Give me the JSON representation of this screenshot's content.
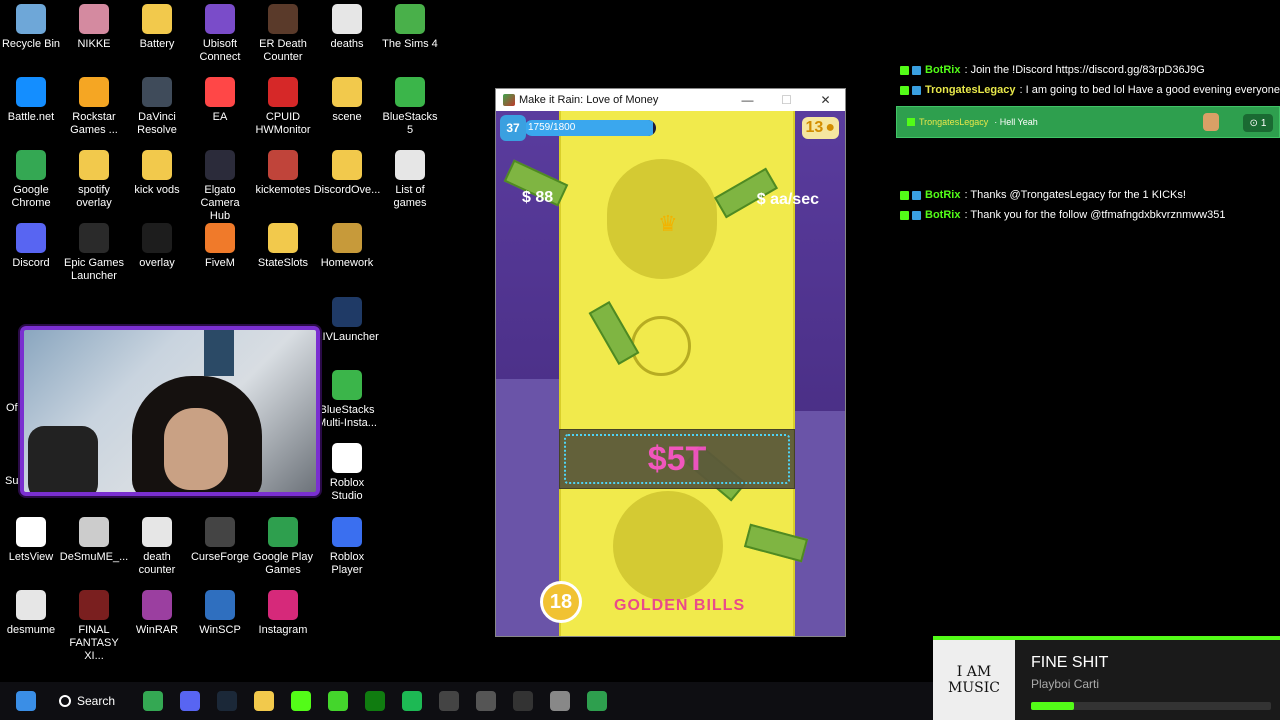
{
  "desktop_icons": [
    {
      "label": "Recycle Bin",
      "icon": "recycle-bin-icon",
      "color": "#6ea7d8"
    },
    {
      "label": "NIKKE",
      "icon": "nikke-icon",
      "color": "#d48aa0"
    },
    {
      "label": "Battery",
      "icon": "folder-icon",
      "color": "#f2c94c"
    },
    {
      "label": "Ubisoft\nConnect",
      "icon": "ubisoft-icon",
      "color": "#7a4cc9"
    },
    {
      "label": "ER Death\nCounter",
      "icon": "er-death-counter-icon",
      "color": "#5a3a2a"
    },
    {
      "label": "deaths",
      "icon": "file-icon",
      "color": "#e6e6e6"
    },
    {
      "label": "The Sims 4",
      "icon": "sims-icon",
      "color": "#49b04a"
    },
    {
      "label": "Battle.net",
      "icon": "battlenet-icon",
      "color": "#148eff"
    },
    {
      "label": "Rockstar\nGames ...",
      "icon": "rockstar-icon",
      "color": "#f5a623"
    },
    {
      "label": "DaVinci\nResolve",
      "icon": "davinci-icon",
      "color": "#3f4b5a"
    },
    {
      "label": "EA",
      "icon": "ea-icon",
      "color": "#ff4747"
    },
    {
      "label": "CPUID\nHWMonitor",
      "icon": "hwmonitor-icon",
      "color": "#d62828"
    },
    {
      "label": "scene",
      "icon": "folder-icon",
      "color": "#f2c94c"
    },
    {
      "label": "BlueStacks 5",
      "icon": "bluestacks-icon",
      "color": "#3bb54a"
    },
    {
      "label": "Google\nChrome",
      "icon": "chrome-icon",
      "color": "#34a853"
    },
    {
      "label": "spotify\noverlay",
      "icon": "folder-icon",
      "color": "#f2c94c"
    },
    {
      "label": "kick vods",
      "icon": "folder-icon",
      "color": "#f2c94c"
    },
    {
      "label": "Elgato\nCamera Hub",
      "icon": "elgato-icon",
      "color": "#2b2b3a"
    },
    {
      "label": "kickemotes",
      "icon": "folder-icon",
      "color": "#c0443a"
    },
    {
      "label": "DiscordOve...",
      "icon": "folder-icon",
      "color": "#f2c94c"
    },
    {
      "label": "List of games",
      "icon": "file-icon",
      "color": "#e6e6e6"
    },
    {
      "label": "Discord",
      "icon": "discord-icon",
      "color": "#5865f2"
    },
    {
      "label": "Epic Games\nLauncher",
      "icon": "epic-icon",
      "color": "#2a2a2a"
    },
    {
      "label": "overlay",
      "icon": "folder-icon",
      "color": "#1d1d1d"
    },
    {
      "label": "FiveM",
      "icon": "fivem-icon",
      "color": "#f07a2a"
    },
    {
      "label": "StateSlots",
      "icon": "folder-icon",
      "color": "#f2c94c"
    },
    {
      "label": "Homework",
      "icon": "folder-icon",
      "color": "#c79a3a"
    },
    {
      "label": "XIVLauncher",
      "icon": "xivlauncher-icon",
      "color": "#1f3a66"
    },
    {
      "label": "BlueStacks\nMulti-Insta...",
      "icon": "bluestacks-multi-icon",
      "color": "#3bb54a"
    },
    {
      "label": "Roblox\nStudio",
      "icon": "roblox-studio-icon",
      "color": "#ffffff"
    },
    {
      "label": "LetsView",
      "icon": "letsview-icon",
      "color": "#ffffff"
    },
    {
      "label": "DeSmuME_...",
      "icon": "desmume-icon",
      "color": "#cccccc"
    },
    {
      "label": "death\ncounter",
      "icon": "file-icon",
      "color": "#e6e6e6"
    },
    {
      "label": "CurseForge",
      "icon": "curseforge-icon",
      "color": "#444444"
    },
    {
      "label": "Google Play\nGames",
      "icon": "google-play-games-icon",
      "color": "#2e9f4e"
    },
    {
      "label": "Roblox Player",
      "icon": "roblox-player-icon",
      "color": "#3a6ff0"
    },
    {
      "label": "desmume",
      "icon": "desmume-file-icon",
      "color": "#e6e6e6"
    },
    {
      "label": "FINAL\nFANTASY XI...",
      "icon": "ffxi-icon",
      "color": "#7a1f1f"
    },
    {
      "label": "WinRAR",
      "icon": "winrar-icon",
      "color": "#9b3fa0"
    },
    {
      "label": "WinSCP",
      "icon": "winscp-icon",
      "color": "#2f6fbf"
    },
    {
      "label": "Instagram",
      "icon": "instagram-icon",
      "color": "#d6297a"
    }
  ],
  "partial_labels": {
    "left_a": "Of",
    "left_b": "Su"
  },
  "game_window": {
    "title": "Make it Rain: Love of Money",
    "minimize": "—",
    "maximize": "☐",
    "close": "✕",
    "level": "37",
    "xp_text": "1759/1800",
    "xp_fraction": 0.977,
    "gold": "13",
    "money_left": "$ 88",
    "money_right": "$ aa/sec",
    "score": "$5T",
    "timer": "18",
    "golden_label": "GOLDEN BILLS"
  },
  "chat": {
    "messages": [
      {
        "user": "BotRix",
        "text": ": Join the !Discord https://discord.gg/83rpD36J9G",
        "user_color": "#53fc18"
      },
      {
        "user": "TrongatesLegacy",
        "text": ": I am going to bed lol Have a good evening everyone",
        "user_color": "#e7e74a"
      }
    ],
    "alert": {
      "user": "TrongatesLegacy",
      "text": "· Hell Yeah",
      "amount": "1"
    },
    "messages_after": [
      {
        "user": "BotRix",
        "text": ": Thanks @TrongatesLegacy for the 1 KICKs!"
      },
      {
        "user": "BotRix",
        "text": ": Thank you for the follow @tfmafngdxbkvrznmww351"
      }
    ]
  },
  "music": {
    "art_text": "I AM MUSIC",
    "song": "FINE SHIT",
    "artist": "Playboi Carti",
    "progress": 0.18
  },
  "taskbar": {
    "search_label": "Search",
    "items": [
      {
        "icon": "windows-start-icon",
        "color": "#3a8ee6"
      },
      {
        "icon": "chrome-icon",
        "color": "#34a853"
      },
      {
        "icon": "discord-icon",
        "color": "#5865f2"
      },
      {
        "icon": "steam-icon",
        "color": "#1b2838"
      },
      {
        "icon": "file-explorer-icon",
        "color": "#f2c94c"
      },
      {
        "icon": "kick-icon",
        "color": "#53fc18"
      },
      {
        "icon": "razer-icon",
        "color": "#44d62c"
      },
      {
        "icon": "xbox-icon",
        "color": "#107c10"
      },
      {
        "icon": "spotify-icon",
        "color": "#1db954"
      },
      {
        "icon": "elgato-icon",
        "color": "#444444"
      },
      {
        "icon": "app-icon",
        "color": "#555555"
      },
      {
        "icon": "obs-icon",
        "color": "#333333"
      },
      {
        "icon": "settings-icon",
        "color": "#888888"
      },
      {
        "icon": "make-it-rain-icon",
        "color": "#2e9f4e"
      }
    ]
  }
}
